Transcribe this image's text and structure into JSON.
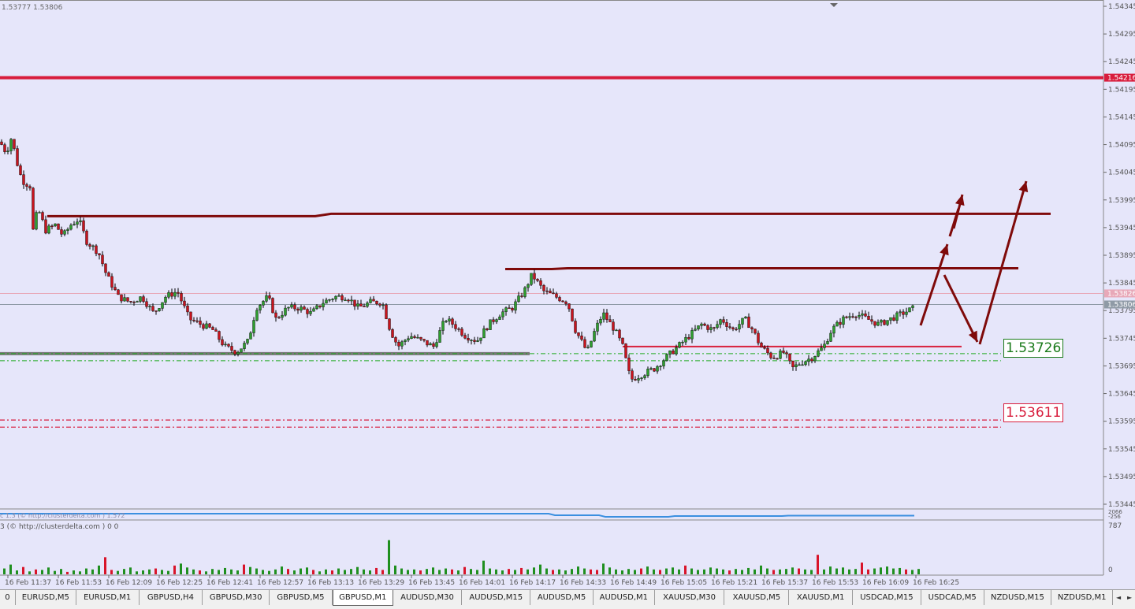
{
  "chart_data": {
    "type": "candlestick",
    "symbol": "GBPUSD",
    "timeframe": "M1",
    "ohlc_readout": "1.53777 1.53806",
    "price_axis": {
      "ticks": [
        "1.54345",
        "1.54295",
        "1.54245",
        "1.54195",
        "1.54145",
        "1.54095",
        "1.54045",
        "1.53995",
        "1.53945",
        "1.53895",
        "1.53845",
        "1.53795",
        "1.53745",
        "1.53695",
        "1.53645",
        "1.53595",
        "1.53545",
        "1.53495",
        "1.53445"
      ],
      "markers": [
        {
          "text": "1.54216",
          "value": 1.54216,
          "color": "#d81c3c"
        },
        {
          "text": "1.53826",
          "value": 1.53826,
          "color": "#e8a8b8"
        },
        {
          "text": "1.53806",
          "value": 1.53806,
          "color": "#8f9aa6"
        }
      ]
    },
    "time_axis": [
      "16 Feb 11:37",
      "16 Feb 11:53",
      "16 Feb 12:09",
      "16 Feb 12:25",
      "16 Feb 12:41",
      "16 Feb 12:57",
      "16 Feb 13:13",
      "16 Feb 13:29",
      "16 Feb 13:45",
      "16 Feb 14:01",
      "16 Feb 14:17",
      "16 Feb 14:33",
      "16 Feb 14:49",
      "16 Feb 15:05",
      "16 Feb 15:21",
      "16 Feb 15:37",
      "16 Feb 15:53",
      "16 Feb 16:09",
      "16 Feb 16:25"
    ],
    "price_path": [
      [
        0,
        1.541
      ],
      [
        8,
        1.5408
      ],
      [
        15,
        1.5411
      ],
      [
        20,
        1.5407
      ],
      [
        28,
        1.5403
      ],
      [
        38,
        1.5402
      ],
      [
        42,
        1.5394
      ],
      [
        48,
        1.5398
      ],
      [
        58,
        1.5394
      ],
      [
        70,
        1.5395
      ],
      [
        80,
        1.5393
      ],
      [
        90,
        1.5395
      ],
      [
        100,
        1.5396
      ],
      [
        110,
        1.5392
      ],
      [
        125,
        1.539
      ],
      [
        135,
        1.5386
      ],
      [
        150,
        1.5382
      ],
      [
        165,
        1.5381
      ],
      [
        180,
        1.5382
      ],
      [
        195,
        1.5379
      ],
      [
        210,
        1.5382
      ],
      [
        225,
        1.5383
      ],
      [
        240,
        1.5378
      ],
      [
        255,
        1.5377
      ],
      [
        270,
        1.5376
      ],
      [
        285,
        1.5373
      ],
      [
        300,
        1.5372
      ],
      [
        315,
        1.5374
      ],
      [
        325,
        1.538
      ],
      [
        340,
        1.5382
      ],
      [
        350,
        1.5378
      ],
      [
        365,
        1.538
      ],
      [
        380,
        1.538
      ],
      [
        395,
        1.5379
      ],
      [
        410,
        1.5381
      ],
      [
        425,
        1.5382
      ],
      [
        440,
        1.5382
      ],
      [
        455,
        1.538
      ],
      [
        470,
        1.5381
      ],
      [
        485,
        1.5381
      ],
      [
        495,
        1.5376
      ],
      [
        505,
        1.5373
      ],
      [
        520,
        1.5375
      ],
      [
        535,
        1.5374
      ],
      [
        550,
        1.5373
      ],
      [
        565,
        1.5378
      ],
      [
        575,
        1.5377
      ],
      [
        590,
        1.5375
      ],
      [
        605,
        1.5374
      ],
      [
        620,
        1.5377
      ],
      [
        635,
        1.5379
      ],
      [
        650,
        1.538
      ],
      [
        665,
        1.5383
      ],
      [
        675,
        1.5386
      ],
      [
        690,
        1.5383
      ],
      [
        705,
        1.5382
      ],
      [
        720,
        1.5381
      ],
      [
        730,
        1.5376
      ],
      [
        745,
        1.5372
      ],
      [
        755,
        1.5376
      ],
      [
        765,
        1.5379
      ],
      [
        780,
        1.5376
      ],
      [
        790,
        1.5373
      ],
      [
        800,
        1.5367
      ],
      [
        815,
        1.5368
      ],
      [
        830,
        1.5369
      ],
      [
        845,
        1.5371
      ],
      [
        860,
        1.5373
      ],
      [
        875,
        1.5375
      ],
      [
        890,
        1.5377
      ],
      [
        905,
        1.5376
      ],
      [
        915,
        1.5378
      ],
      [
        930,
        1.5376
      ],
      [
        945,
        1.5378
      ],
      [
        955,
        1.5376
      ],
      [
        965,
        1.5373
      ],
      [
        980,
        1.5371
      ],
      [
        995,
        1.5372
      ],
      [
        1005,
        1.5369
      ],
      [
        1015,
        1.537
      ],
      [
        1030,
        1.5371
      ],
      [
        1045,
        1.5373
      ],
      [
        1055,
        1.5376
      ],
      [
        1070,
        1.5378
      ],
      [
        1085,
        1.5379
      ],
      [
        1100,
        1.5378
      ],
      [
        1115,
        1.5377
      ],
      [
        1130,
        1.5378
      ],
      [
        1145,
        1.5379
      ],
      [
        1160,
        1.538
      ]
    ],
    "overlays": {
      "res_high": {
        "value": 1.5397,
        "color": "#7f0a0a"
      },
      "res_mid": {
        "value": 1.5387,
        "color": "#7f0a0a"
      },
      "support_red": {
        "value": 1.5373,
        "color": "#d8203c"
      },
      "support_gray": {
        "value": 1.5372,
        "color": "#777777"
      },
      "top_red": {
        "value": 1.54216,
        "color": "#d81c3c"
      },
      "current_line": {
        "value": 1.53806,
        "color": "#8f9aa6"
      },
      "pink_line": {
        "value": 1.53826,
        "color": "#e8a8b8"
      },
      "green_dash_a": {
        "value": 1.5373,
        "color": "#1faa1f"
      },
      "green_dash_b": {
        "value": 1.5371,
        "color": "#1faa1f"
      },
      "red_dash_a": {
        "value": 1.536,
        "color": "#d81c3c"
      },
      "red_dash_b": {
        "value": 1.5359,
        "color": "#d81c3c"
      }
    },
    "level_labels": [
      {
        "text": "1.53726",
        "value": 1.53726,
        "color": "#1a7a1a"
      },
      {
        "text": "1.53611",
        "value": 1.53611,
        "color": "#d81c3c"
      }
    ],
    "indicators": {
      "delta_label": "c 1.3 (© http://clusterdelta.com ) 1.572",
      "delta_axis": [
        "2066",
        "-256"
      ],
      "volume_label": "3 (© http://clusterdelta.com ) 0 0",
      "volume_axis": [
        "787",
        "0"
      ],
      "volume_max": 787,
      "volume_bars": [
        12,
        20,
        8,
        15,
        6,
        10,
        9,
        14,
        7,
        11,
        5,
        8,
        6,
        12,
        10,
        18,
        35,
        9,
        7,
        11,
        14,
        6,
        8,
        10,
        12,
        9,
        7,
        18,
        22,
        14,
        10,
        8,
        6,
        11,
        9,
        13,
        10,
        8,
        20,
        15,
        12,
        9,
        7,
        10,
        16,
        11,
        8,
        12,
        14,
        9,
        6,
        10,
        8,
        12,
        9,
        11,
        15,
        10,
        8,
        13,
        9,
        70,
        18,
        12,
        9,
        10,
        8,
        11,
        14,
        9,
        12,
        10,
        8,
        15,
        11,
        9,
        28,
        12,
        10,
        8,
        11,
        9,
        13,
        10,
        14,
        20,
        12,
        9,
        10,
        8,
        11,
        16,
        12,
        10,
        9,
        22,
        14,
        10,
        8,
        11,
        9,
        12,
        16,
        10,
        9,
        12,
        14,
        10,
        18,
        12,
        9,
        10,
        14,
        12,
        10,
        8,
        11,
        9,
        13,
        10,
        18,
        12,
        9,
        10,
        11,
        14,
        12,
        10,
        9,
        40,
        10,
        16,
        12,
        14,
        10,
        11,
        24,
        10,
        12,
        14,
        16,
        12,
        13,
        10,
        9,
        11
      ]
    }
  },
  "tabs": [
    {
      "label": "0",
      "active": false
    },
    {
      "label": "EURUSD,M5",
      "active": false
    },
    {
      "label": "EURUSD,M1",
      "active": false
    },
    {
      "label": "GBPUSD,H4",
      "active": false
    },
    {
      "label": "GBPUSD,M30",
      "active": false
    },
    {
      "label": "GBPUSD,M5",
      "active": false
    },
    {
      "label": "GBPUSD,M1",
      "active": true
    },
    {
      "label": "AUDUSD,M30",
      "active": false
    },
    {
      "label": "AUDUSD,M15",
      "active": false
    },
    {
      "label": "AUDUSD,M5",
      "active": false
    },
    {
      "label": "AUDUSD,M1",
      "active": false
    },
    {
      "label": "XAUUSD,M30",
      "active": false
    },
    {
      "label": "XAUUSD,M5",
      "active": false
    },
    {
      "label": "XAUUSD,M1",
      "active": false
    },
    {
      "label": "USDCAD,M15",
      "active": false
    },
    {
      "label": "USDCAD,M5",
      "active": false
    },
    {
      "label": "NZDUSD,M15",
      "active": false
    },
    {
      "label": "NZDUSD,M1",
      "active": false
    }
  ],
  "tab_scroll": {
    "left_icon": "arrow-left-icon",
    "right_icon": "arrow-right-icon"
  }
}
